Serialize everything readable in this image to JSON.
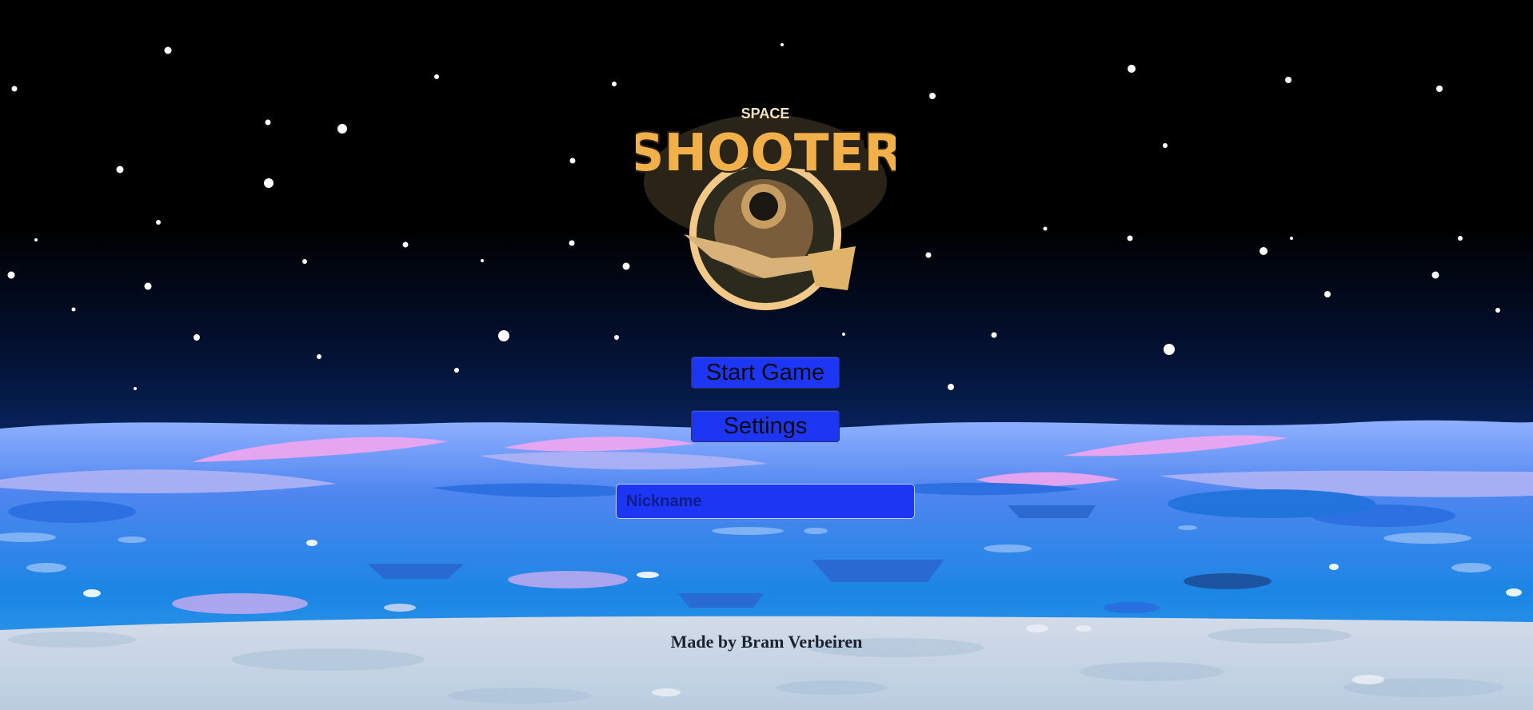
{
  "game": {
    "logo": {
      "top_word": "SPACE",
      "main_word": "SHOOTER",
      "icon": "astronaut-on-rocket-icon"
    },
    "menu": {
      "start_label": "Start Game",
      "settings_label": "Settings",
      "nickname_placeholder": "Nickname",
      "nickname_value": ""
    },
    "footer": {
      "credit": "Made by Bram Verbeiren"
    }
  },
  "colors": {
    "button_bg": "#1c36f4",
    "sky_top": "#000000",
    "sky_bottom": "#0a2a6a",
    "logo_gold": "#f1b04a",
    "logo_dark": "#2a2418"
  }
}
